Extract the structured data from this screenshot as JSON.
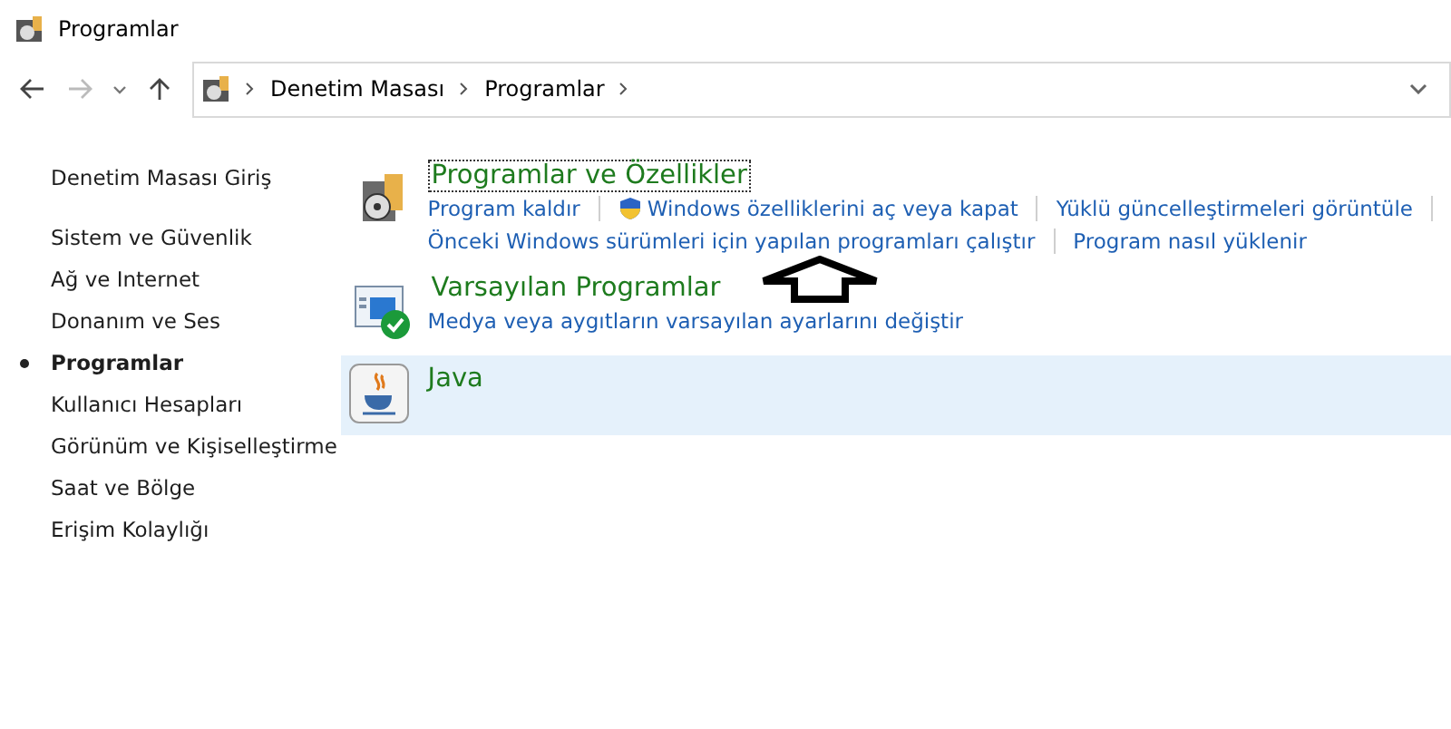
{
  "window": {
    "title": "Programlar"
  },
  "address_bar": {
    "breadcrumbs": [
      "Denetim Masası",
      "Programlar"
    ]
  },
  "sidebar": {
    "home": "Denetim Masası Giriş",
    "items": [
      {
        "label": "Sistem ve Güvenlik",
        "selected": false
      },
      {
        "label": "Ağ ve Internet",
        "selected": false
      },
      {
        "label": "Donanım ve Ses",
        "selected": false
      },
      {
        "label": "Programlar",
        "selected": true
      },
      {
        "label": "Kullanıcı Hesapları",
        "selected": false
      },
      {
        "label": "Görünüm ve Kişiselleştirme",
        "selected": false
      },
      {
        "label": "Saat ve Bölge",
        "selected": false
      },
      {
        "label": "Erişim Kolaylığı",
        "selected": false
      }
    ]
  },
  "sections": [
    {
      "kind": "programs",
      "title": "Programlar ve Özellikler",
      "selected": false,
      "focused": true,
      "link_rows": [
        [
          {
            "label": "Program kaldır",
            "shield": false
          },
          {
            "label": "Windows özelliklerini aç veya kapat",
            "shield": true
          },
          {
            "label": "Yüklü güncelleştirmeleri görüntüle",
            "shield": false
          }
        ],
        [
          {
            "label": "Önceki Windows sürümleri için yapılan programları çalıştır",
            "shield": false
          },
          {
            "label": "Program nasıl yüklenir",
            "shield": false
          }
        ]
      ]
    },
    {
      "kind": "defaults",
      "title": "Varsayılan Programlar",
      "selected": false,
      "focused": false,
      "link_rows": [
        [
          {
            "label": "Medya veya aygıtların varsayılan ayarlarını değiştir",
            "shield": false
          }
        ]
      ]
    },
    {
      "kind": "java",
      "title": "Java",
      "selected": true,
      "focused": false
    }
  ]
}
